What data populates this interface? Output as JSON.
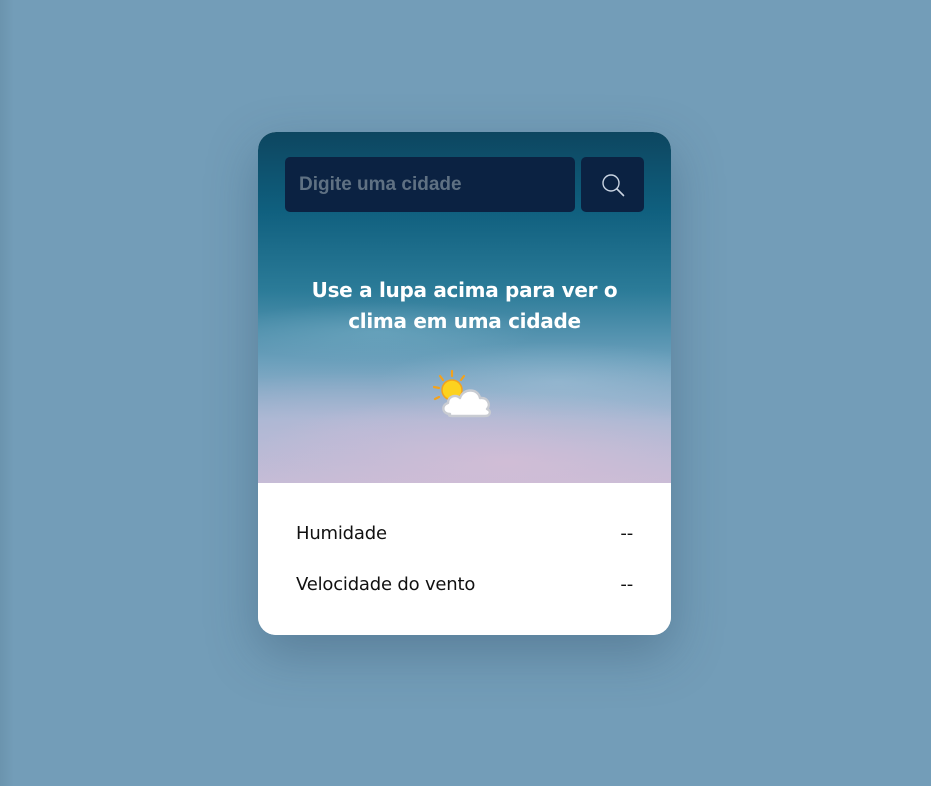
{
  "search": {
    "placeholder": "Digite uma cidade",
    "value": ""
  },
  "message": {
    "text": "Use a lupa acima para ver o clima em uma cidade"
  },
  "weather_icon": {
    "name": "sun-behind-cloud-icon"
  },
  "details": [
    {
      "label": "Humidade",
      "value": "--"
    },
    {
      "label": "Velocidade do vento",
      "value": "--"
    }
  ],
  "colors": {
    "page_background": "#739db8",
    "search_background": "#0b2242",
    "card_bottom": "#ffffff",
    "text_white": "#ffffff"
  }
}
